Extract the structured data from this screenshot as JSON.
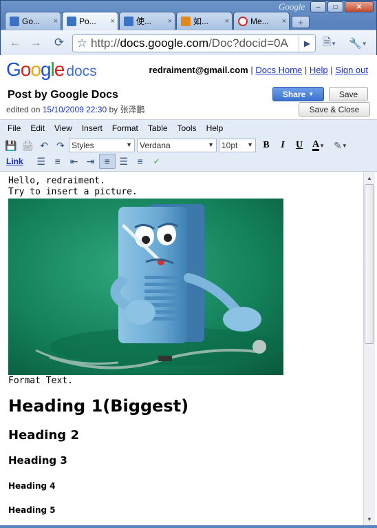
{
  "browser": {
    "tabs": [
      {
        "title": "Go...",
        "close": "×",
        "favicon_color": "#3a72c4"
      },
      {
        "title": "Po...",
        "close": "×",
        "favicon_color": "#3a72c4",
        "active": true
      },
      {
        "title": "使...",
        "close": "×",
        "favicon_color": "#3a72c4"
      },
      {
        "title": "如...",
        "close": "×",
        "favicon_color": "#e08a1e"
      },
      {
        "title": "Me...",
        "close": "×",
        "favicon_color": "#d22b2b"
      }
    ],
    "new_tab": "+",
    "watermark": "Google",
    "window_buttons": {
      "minimize": "–",
      "maximize": "□",
      "close": "✕"
    },
    "back_icon": "arrow-left-icon",
    "forward_icon": "arrow-right-icon",
    "url_host_prefix": "http://",
    "url_host": "docs.google.com",
    "url_path": "/Doc?docid=0A",
    "go": "▶"
  },
  "header": {
    "logo": {
      "g1": "G",
      "g2": "o",
      "g3": "o",
      "g4": "g",
      "g5": "l",
      "g6": "e",
      "docs": "docs"
    },
    "email": "redraiment@gmail.com",
    "sep": "|",
    "docs_home": "Docs Home",
    "help": "Help",
    "sign_out": "Sign out",
    "title": "Post by Google Docs",
    "edited_prefix": "edited on",
    "edited_when": "15/10/2009 22:30",
    "edited_by_prefix": "by",
    "edited_by": "张泽鹏",
    "share": "Share",
    "save": "Save",
    "save_close": "Save & Close"
  },
  "menubar": [
    "File",
    "Edit",
    "View",
    "Insert",
    "Format",
    "Table",
    "Tools",
    "Help"
  ],
  "toolbar": {
    "styles": "Styles",
    "font": "Verdana",
    "size": "10pt",
    "bold": "B",
    "italic": "I",
    "underline": "U",
    "text_color": "A",
    "link": "Link"
  },
  "document": {
    "line1": "Hello, redraiment.",
    "line2": "Try to insert a picture.",
    "picture_alt": "Sick computer cartoon",
    "line3": "Format Text.",
    "h1": "Heading 1(Biggest)",
    "h2": "Heading 2",
    "h3": "Heading 3",
    "h4": "Heading 4",
    "h5": "Heading 5"
  }
}
